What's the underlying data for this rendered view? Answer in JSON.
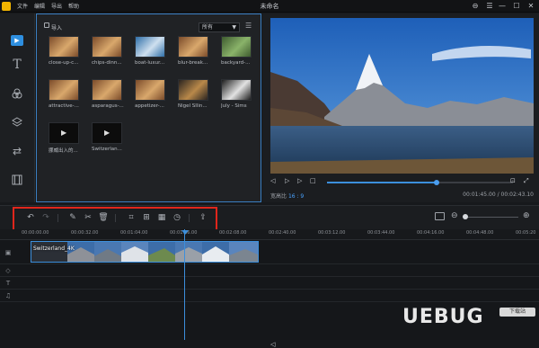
{
  "titlebar": {
    "menus": [
      "文件",
      "编辑",
      "导出",
      "帮助"
    ],
    "title": "未命名",
    "buttons": [
      "⊖",
      "☰",
      "—",
      "☐",
      "✕"
    ]
  },
  "library": {
    "import_label": "导入",
    "filter_value": "所有",
    "items": [
      {
        "caption": "close-up-c...",
        "kind": "food"
      },
      {
        "caption": "chips-dinn...",
        "kind": "food"
      },
      {
        "caption": "boat-luxur...",
        "kind": "sea"
      },
      {
        "caption": "blur-break...",
        "kind": "food"
      },
      {
        "caption": "backyard-...",
        "kind": "garden"
      },
      {
        "caption": "attractive-...",
        "kind": "food"
      },
      {
        "caption": "asparagus-...",
        "kind": "food"
      },
      {
        "caption": "appetizer-...",
        "kind": "food"
      },
      {
        "caption": "Nigel Sllin...",
        "kind": "dark"
      },
      {
        "caption": "July - Sims",
        "kind": "bw"
      },
      {
        "caption": "挪威出入的...",
        "kind": "video"
      },
      {
        "caption": "Switzerlan...",
        "kind": "video"
      }
    ]
  },
  "preview": {
    "ratio_label": "宽高比",
    "ratio_value": "16 : 9",
    "timecode": "00:01:45.00 / 00:02:43.10",
    "progress": 0.59
  },
  "toolbar": {
    "tools": [
      "undo",
      "redo",
      "edit",
      "cut",
      "delete",
      "crop",
      "zoom-crop",
      "freeze-frame",
      "speed",
      "export-clip"
    ]
  },
  "timeline": {
    "ticks": [
      "00:00:00.00",
      "00:00:32.00",
      "00:01:04.00",
      "00:01:36.00",
      "00:02:08.00",
      "00:02:40.00",
      "00:03:12.00",
      "00:03:44.00",
      "00:04:16.00",
      "00:04:48.00",
      "00:05:20"
    ],
    "clip_label": "Switzerland_4K",
    "zoom_level": 0.05
  },
  "watermark": {
    "text": "UEBUG",
    "badge": "下载站"
  }
}
